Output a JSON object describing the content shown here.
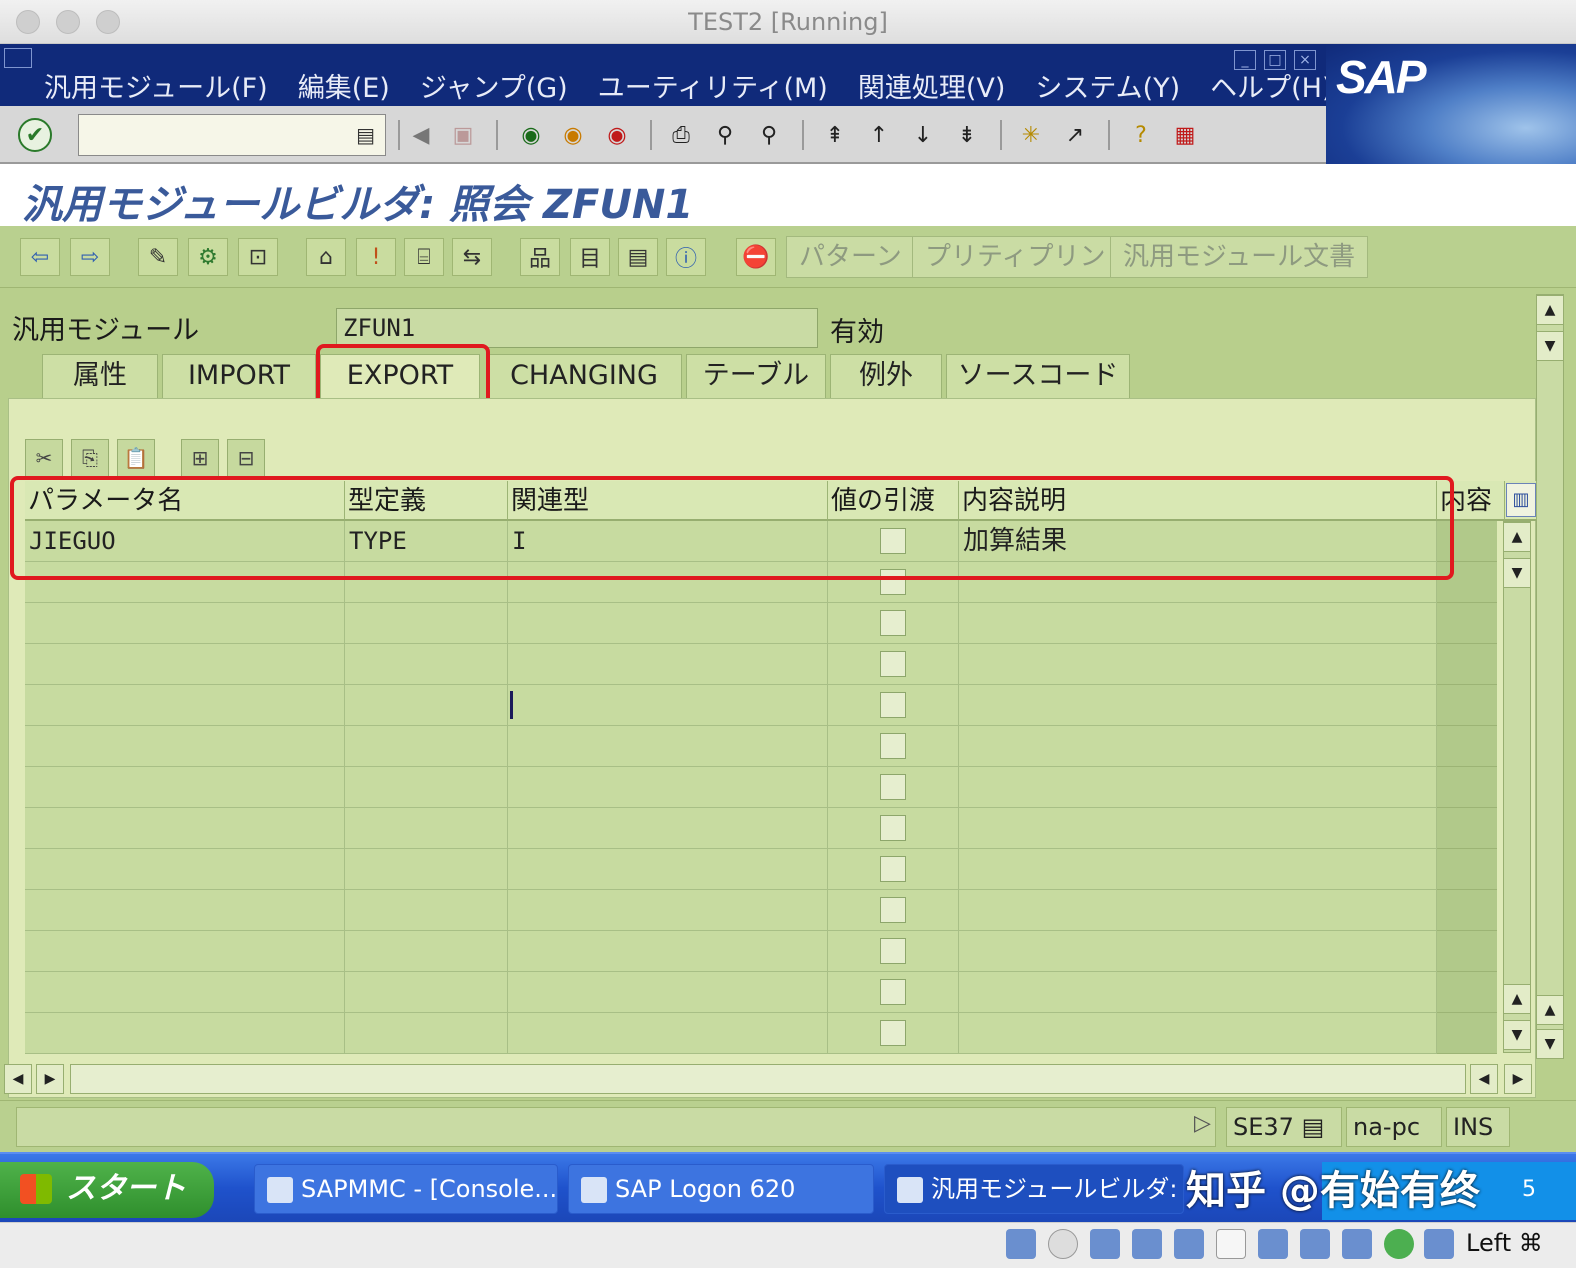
{
  "window": {
    "title": "TEST2 [Running]"
  },
  "menubar": {
    "items": [
      "汎用モジュール(F)",
      "編集(E)",
      "ジャンプ(G)",
      "ユーティリティ(M)",
      "関連処理(V)",
      "システム(Y)",
      "ヘルプ(H)"
    ],
    "logo": "SAP"
  },
  "systoolbar": {
    "command_value": ""
  },
  "screen": {
    "title": "汎用モジュールビルダ: 照会 ZFUN1"
  },
  "apptoolbar": {
    "buttons": [
      "パターン",
      "プリティプリント",
      "汎用モジュール文書"
    ]
  },
  "form": {
    "function_module_label": "汎用モジュール",
    "function_module_value": "ZFUN1",
    "status": "有効"
  },
  "tabs": [
    "属性",
    "IMPORT",
    "EXPORT",
    "CHANGING",
    "テーブル",
    "例外",
    "ソースコード"
  ],
  "active_tab": "EXPORT",
  "table": {
    "columns": [
      "パラメータ名",
      "型定義",
      "関連型",
      "値の引渡",
      "内容説明",
      "内容"
    ],
    "rows": [
      [
        "JIEGUO",
        "TYPE",
        "I",
        "",
        "加算結果"
      ]
    ]
  },
  "statusbar": {
    "transaction": "SE37",
    "host": "na-pc",
    "mode": "INS"
  },
  "taskbar": {
    "start": "スタート",
    "tasks": [
      "SAPMMC - [Console...",
      "SAP Logon 620",
      "汎用モジュールビルダ: ..."
    ],
    "tray_text": "5",
    "watermark": "知乎 @有始有终"
  },
  "vmbar": {
    "host_key": "Left ⌘"
  }
}
